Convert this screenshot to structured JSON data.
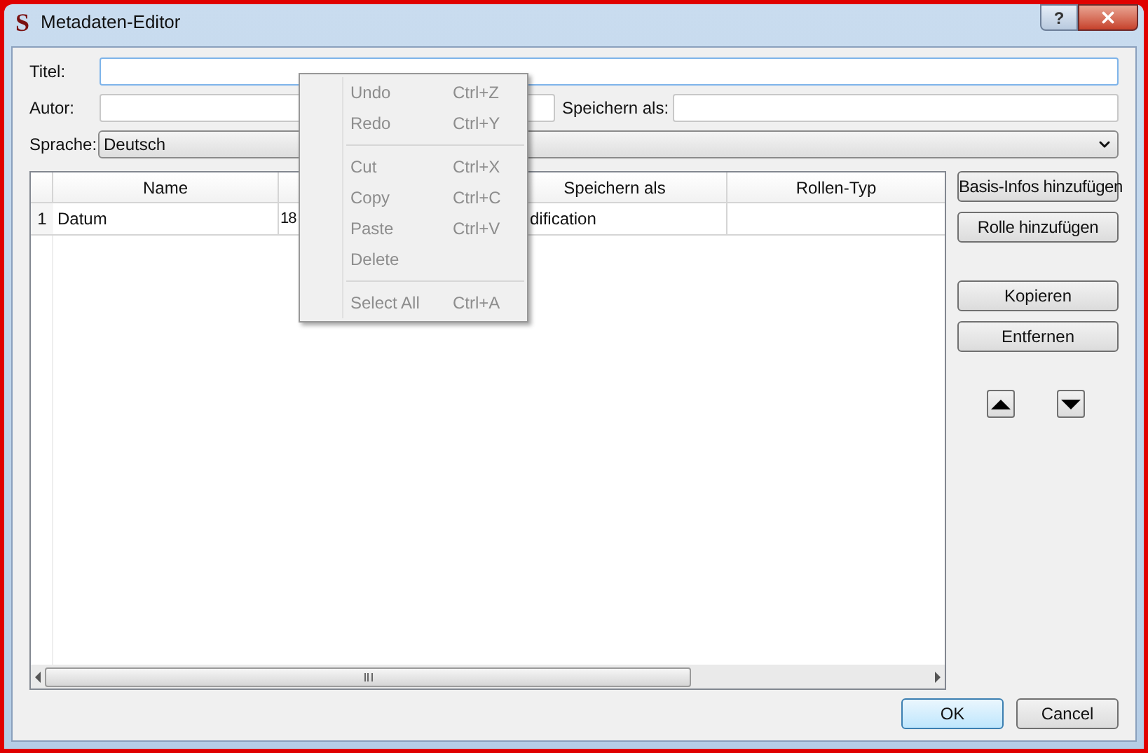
{
  "window": {
    "title": "Metadaten-Editor",
    "logo_letter": "S",
    "help_glyph": "?"
  },
  "form": {
    "title_label": "Titel:",
    "author_label": "Autor:",
    "save_as_label": "Speichern als:",
    "language_label": "Sprache:",
    "language_value": "Deutsch"
  },
  "table": {
    "columns": [
      {
        "label": "Name"
      },
      {
        "label": "Speichern als"
      },
      {
        "label": "Rollen-Typ"
      }
    ],
    "rows": [
      {
        "number": "1",
        "name": "Datum",
        "column_2": "18",
        "save_as": "dification"
      }
    ]
  },
  "side_buttons_top": [
    {
      "label": "Basis-Infos hinzufügen"
    },
    {
      "label": "Rolle hinzufügen"
    }
  ],
  "side_buttons_middle": [
    {
      "label": "Kopieren"
    },
    {
      "label": "Entfernen"
    }
  ],
  "context_menu": [
    {
      "kind": "item",
      "label": "Undo",
      "shortcut": "Ctrl+Z",
      "disabled": true
    },
    {
      "kind": "item",
      "label": "Redo",
      "shortcut": "Ctrl+Y",
      "disabled": true
    },
    {
      "kind": "separator"
    },
    {
      "kind": "item",
      "label": "Cut",
      "shortcut": "Ctrl+X",
      "disabled": true
    },
    {
      "kind": "item",
      "label": "Copy",
      "shortcut": "Ctrl+C",
      "disabled": true
    },
    {
      "kind": "item",
      "label": "Paste",
      "shortcut": "Ctrl+V",
      "disabled": true
    },
    {
      "kind": "item",
      "label": "Delete",
      "disabled": true
    },
    {
      "kind": "separator"
    },
    {
      "kind": "item",
      "label": "Select All",
      "shortcut": "Ctrl+A",
      "disabled": true
    }
  ],
  "dialog_buttons": [
    {
      "label": "OK",
      "default": true
    },
    {
      "label": "Cancel",
      "default": false
    }
  ]
}
